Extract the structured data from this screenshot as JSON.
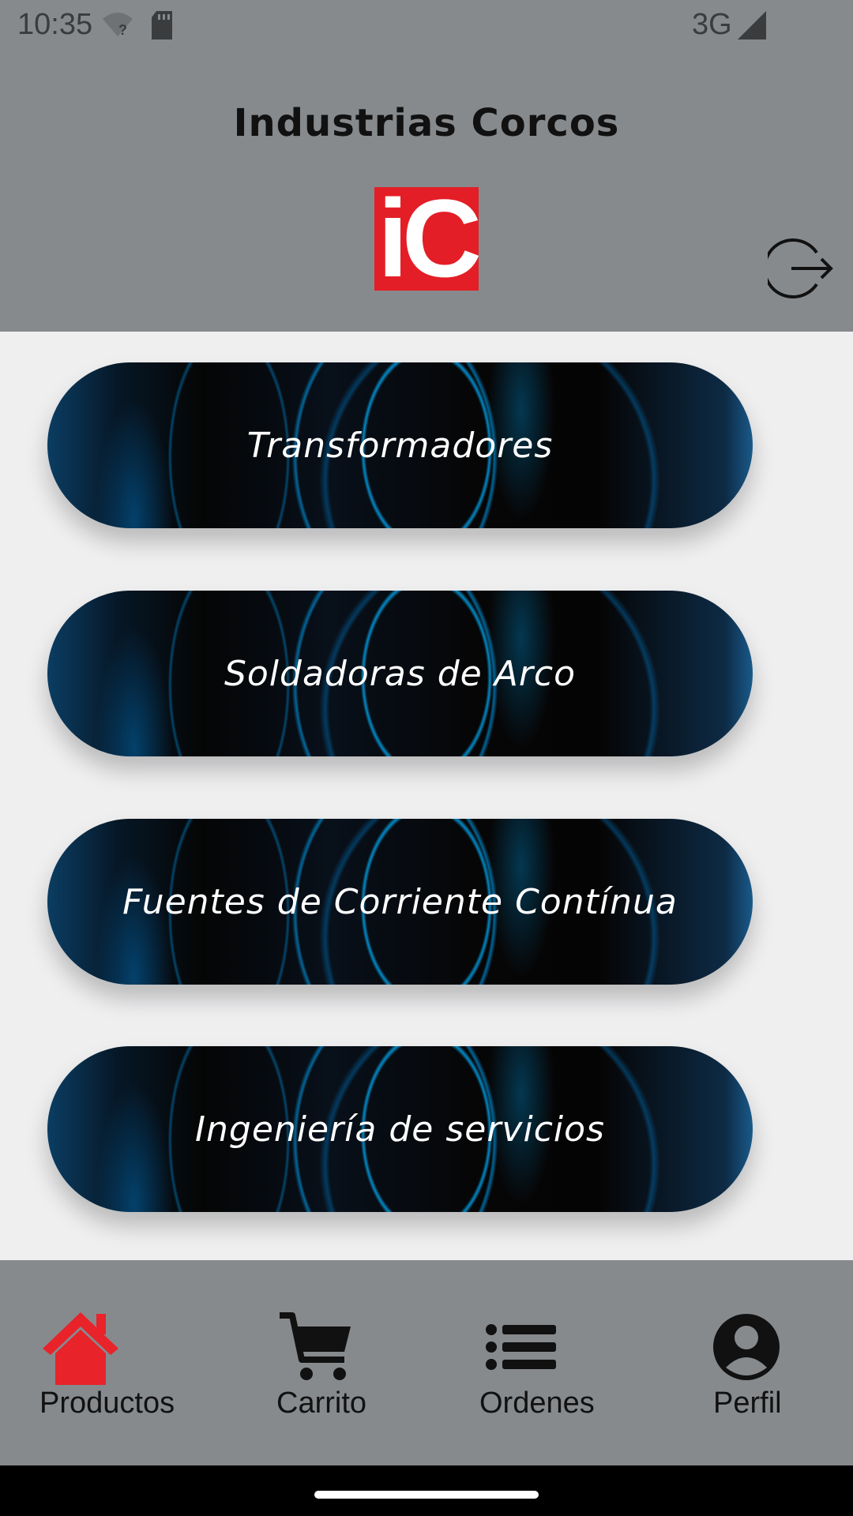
{
  "status_bar": {
    "time": "10:35",
    "network": "3G",
    "icons": [
      "wifi-icon",
      "sd-card-icon",
      "signal-icon"
    ]
  },
  "header": {
    "title": "Industrias Corcos",
    "logo_text": "iC",
    "logo_color": "#e41e26",
    "logout_icon": "logout-icon"
  },
  "categories": [
    {
      "label": "Transformadores"
    },
    {
      "label": "Soldadoras de Arco"
    },
    {
      "label": "Fuentes de Corriente Contínua"
    },
    {
      "label": "Ingeniería de servicios"
    }
  ],
  "bottom_nav": {
    "active_color": "#e8232a",
    "items": [
      {
        "label": "Productos",
        "icon": "home-icon",
        "active": true
      },
      {
        "label": "Carrito",
        "icon": "cart-icon",
        "active": false
      },
      {
        "label": "Ordenes",
        "icon": "list-icon",
        "active": false
      },
      {
        "label": "Perfil",
        "icon": "user-icon",
        "active": false
      }
    ]
  }
}
